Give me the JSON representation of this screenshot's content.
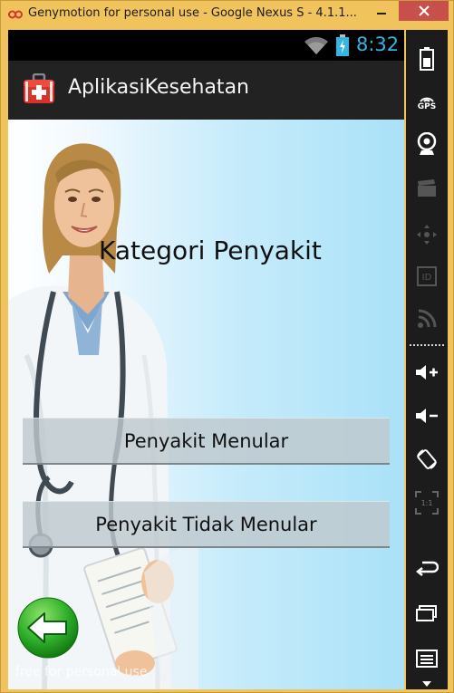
{
  "window": {
    "title": "Genymotion for personal use - Google Nexus S - 4.1.1..."
  },
  "status_bar": {
    "time": "8:32",
    "clock_color": "#33b5e5"
  },
  "action_bar": {
    "title": "AplikasiKesehatan",
    "icon": "first-aid-kit-icon"
  },
  "main": {
    "heading": "Kategori Penyakit",
    "buttons": [
      {
        "label": "Penyakit Menular"
      },
      {
        "label": "Penyakit Tidak Menular"
      }
    ],
    "back_icon": "green-back-arrow-icon",
    "watermark": "free for personal use"
  },
  "toolbar": {
    "gps_label": "GPS",
    "scale_label": "1:1",
    "icons": [
      "battery-icon",
      "gps-icon",
      "camera-icon",
      "media-icon",
      "remote-control-icon",
      "id-icon",
      "rss-icon",
      "volume-up-icon",
      "volume-down-icon",
      "rotate-icon",
      "scale-icon",
      "back-icon",
      "home-icon",
      "menu-icon"
    ]
  },
  "colors": {
    "frame": "#f0c35d",
    "close_button": "#c7504b",
    "action_bar": "#222222",
    "accent": "#33b5e5"
  }
}
